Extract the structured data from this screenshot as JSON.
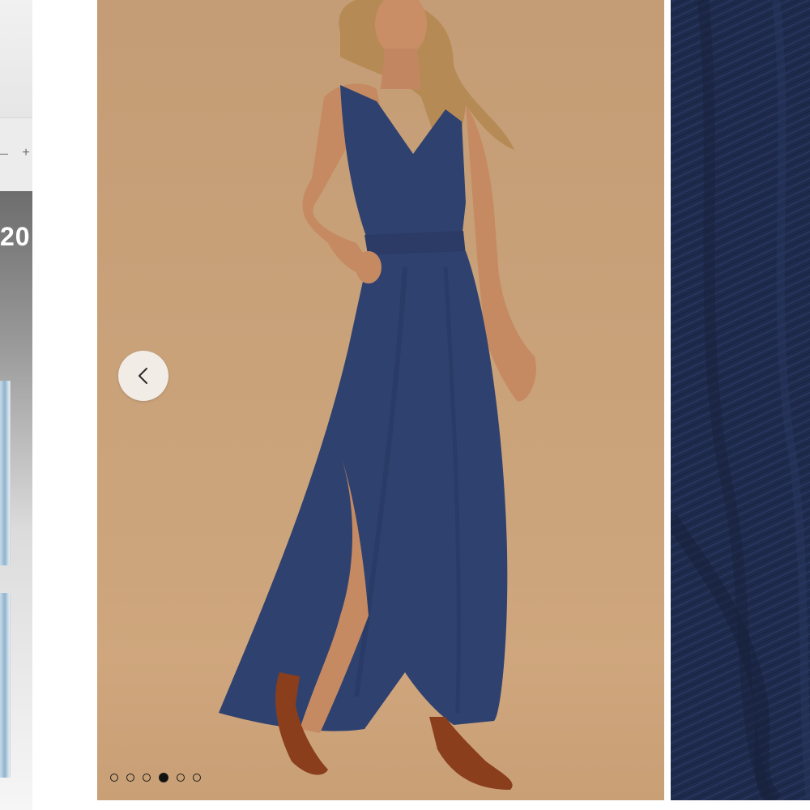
{
  "left_panel": {
    "zoom_minus": "–",
    "zoom_plus": "+",
    "year_fragment": "20"
  },
  "gallery": {
    "prev_icon": "chevron-left-icon",
    "image_count": 6,
    "active_index": 3
  },
  "colors": {
    "backdrop": "#c9a27a",
    "dress": "#2f416f",
    "detail_fabric": "#1e2a4c",
    "dot_active": "#111111"
  }
}
